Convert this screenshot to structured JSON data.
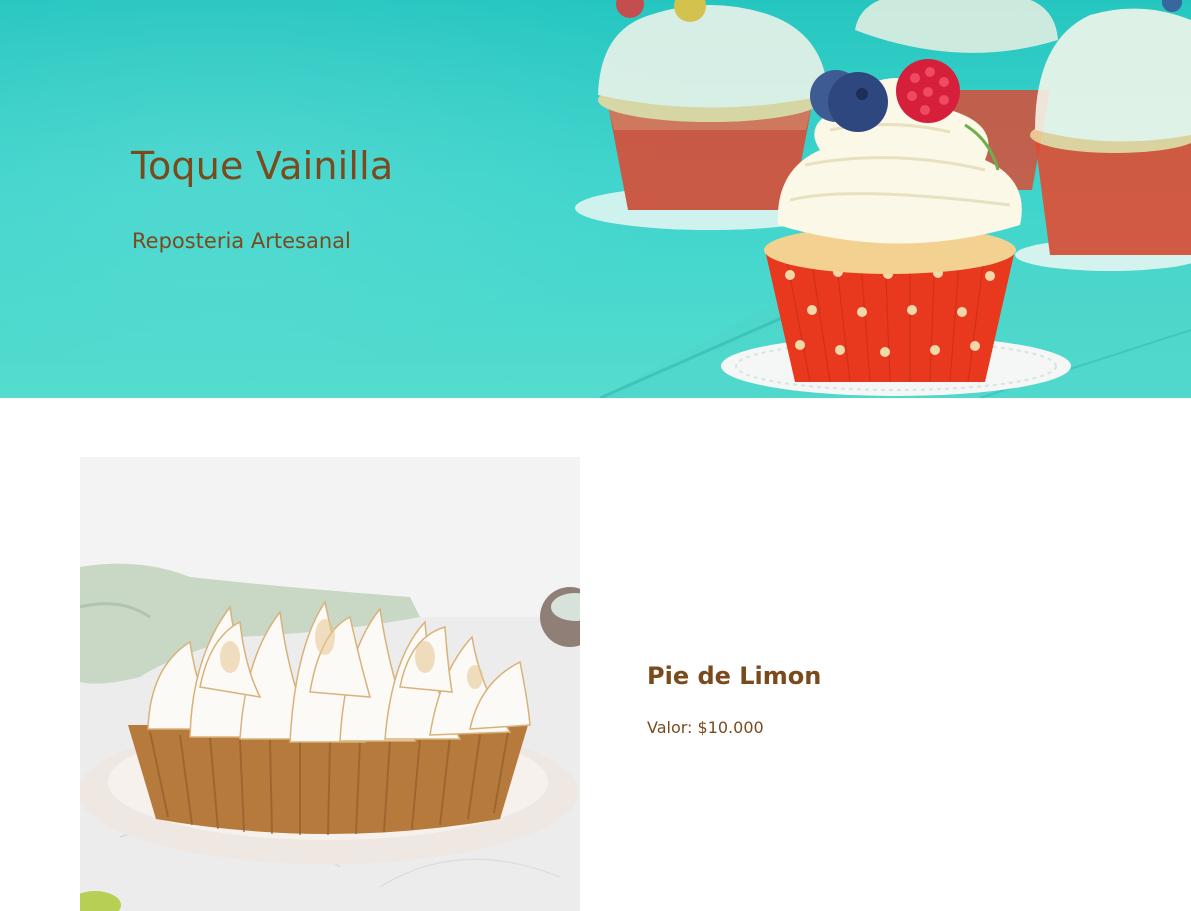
{
  "hero": {
    "title": "Toque Vainilla",
    "subtitle": "Reposteria Artesanal",
    "image": "cupcakes-photo"
  },
  "product": {
    "name": "Pie de Limon",
    "price": "Valor: $10.000",
    "image": "lemon-meringue-pie-photo"
  },
  "colors": {
    "text_brown": "#7a4a1c",
    "hero_teal": "#3dd4cc",
    "page_background": "#ffffff"
  }
}
